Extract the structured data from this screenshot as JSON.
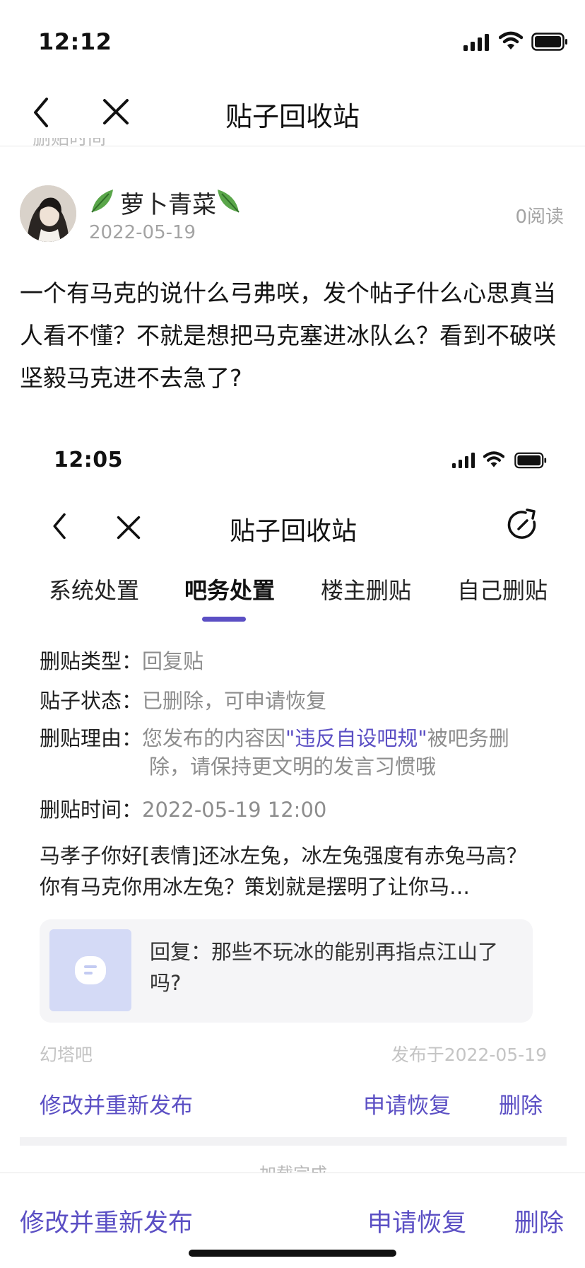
{
  "outer": {
    "status_time": "12:12",
    "nav_title": "贴子回收站",
    "partial_text": "删贴时间",
    "post": {
      "username": "萝卜青菜",
      "date": "2022-05-19",
      "reads": "0阅读",
      "body": "一个有马克的说什么弓弗咲，发个帖子什么心思真当人看不懂？不就是想把马克塞进冰队么？看到不破咲坚毅马克进不去急了?"
    },
    "footer": {
      "edit_label": "修改并重新发布",
      "restore_label": "申请恢复",
      "delete_label": "删除"
    }
  },
  "inner": {
    "status_time": "12:05",
    "nav_title": "贴子回收站",
    "tabs": [
      {
        "label": "系统处置"
      },
      {
        "label": "吧务处置"
      },
      {
        "label": "楼主删贴"
      },
      {
        "label": "自己删贴"
      }
    ],
    "active_tab": 1,
    "info": {
      "type_label": "删贴类型：",
      "type_value": "回复贴",
      "status_label": "贴子状态：",
      "status_value": "已删除，可申请恢复",
      "reason_label": "删贴理由：",
      "reason_pre": "您发布的内容因",
      "reason_highlight": "\"违反自设吧规\"",
      "reason_post": "被吧务删",
      "reason_line2": "除，请保持更文明的发言习惯哦",
      "time_label": "删贴时间：",
      "time_value": "2022-05-19 12:00"
    },
    "content": "马孝子你好[表情]还冰左兔，冰左兔强度有赤兔马高？你有马克你用冰左兔？策划就是摆明了让你马…",
    "reply_line1": "回复：那些不玩冰的能别再指点江山了",
    "reply_line2": "吗?",
    "forum": "幻塔吧",
    "published": "发布于2022-05-19",
    "actions": {
      "edit_label": "修改并重新发布",
      "restore_label": "申请恢复",
      "delete_label": "删除"
    },
    "loading": "加载完成"
  },
  "colors": {
    "accent": "#5b4fc4",
    "muted": "#9a9a9a",
    "reply_bg": "#f5f5f7",
    "thumb_bg": "#d4daf6"
  }
}
